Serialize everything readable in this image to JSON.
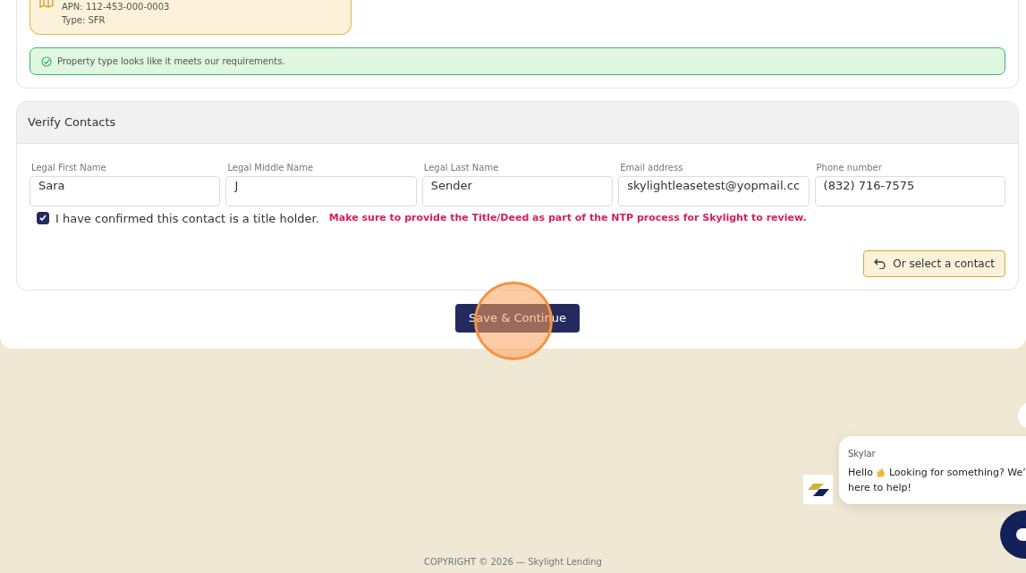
{
  "property": {
    "apn": "APN: 112-453-000-0003",
    "type": "Type: SFR"
  },
  "notice": {
    "text": "Property type looks like it meets our requirements."
  },
  "contacts": {
    "title": "Verify Contacts",
    "fields": [
      {
        "label": "Legal First Name",
        "value": "Sara"
      },
      {
        "label": "Legal Middle Name",
        "value": "J"
      },
      {
        "label": "Legal Last Name",
        "value": "Sender"
      },
      {
        "label": "Email address",
        "value": "skylightleasetest@yopmail.cc"
      },
      {
        "label": "Phone number",
        "value": "(832) 716-7575"
      }
    ],
    "confirm": {
      "checked": true,
      "label": "I have confirmed this contact is a title holder.",
      "warning": "Make sure to provide the Title/Deed as part of the NTP process for Skylight to review."
    },
    "select_button": "Or select a contact"
  },
  "save_button": "Save & Continue",
  "chat": {
    "sender": "Skylar",
    "greeting": "Hello",
    "message": "Looking for something? We’",
    "message_line2": "here to help!"
  },
  "footer": "COPYRIGHT © 2026 — Skylight Lending"
}
